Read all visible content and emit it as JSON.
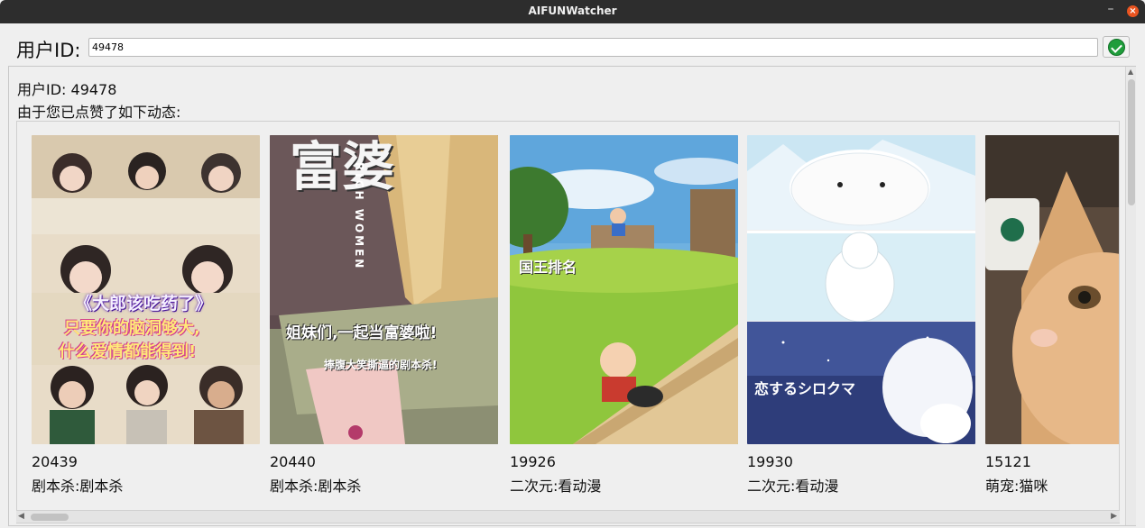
{
  "window": {
    "title": "AIFUNWatcher"
  },
  "user_id": {
    "label": "用户ID:",
    "value": "49478"
  },
  "result": {
    "user_line": "用户ID: 49478",
    "intro_line": "由于您已点赞了如下动态:"
  },
  "cards": [
    {
      "id": "20439",
      "category": "剧本杀:剧本杀",
      "image_text": {
        "headline": "《大郎该吃药了》",
        "line1": "只要你的脑洞够大,",
        "line2": "什么爱情都能得到!"
      }
    },
    {
      "id": "20440",
      "category": "剧本杀:剧本杀",
      "image_text": {
        "headline": "富婆",
        "english": "RICH WOMEN",
        "line1": "姐妹们,一起当富婆啦!",
        "line2": "捧腹大笑撕逼的剧本杀!"
      }
    },
    {
      "id": "19926",
      "category": "二次元:看动漫",
      "image_text": {
        "headline": "国王排名"
      }
    },
    {
      "id": "19930",
      "category": "二次元:看动漫",
      "image_text": {
        "headline": "恋するシロクマ"
      }
    },
    {
      "id": "15121",
      "category": "萌宠:猫咪"
    }
  ],
  "colors": {
    "titlebar": "#2d2d2d",
    "close_button": "#e95420",
    "confirm_check": "#1f9d3b",
    "window_bg": "#efefef"
  },
  "icons": {
    "confirm": "check-circle-icon",
    "close": "close-icon",
    "minimize": "minimize-icon"
  }
}
